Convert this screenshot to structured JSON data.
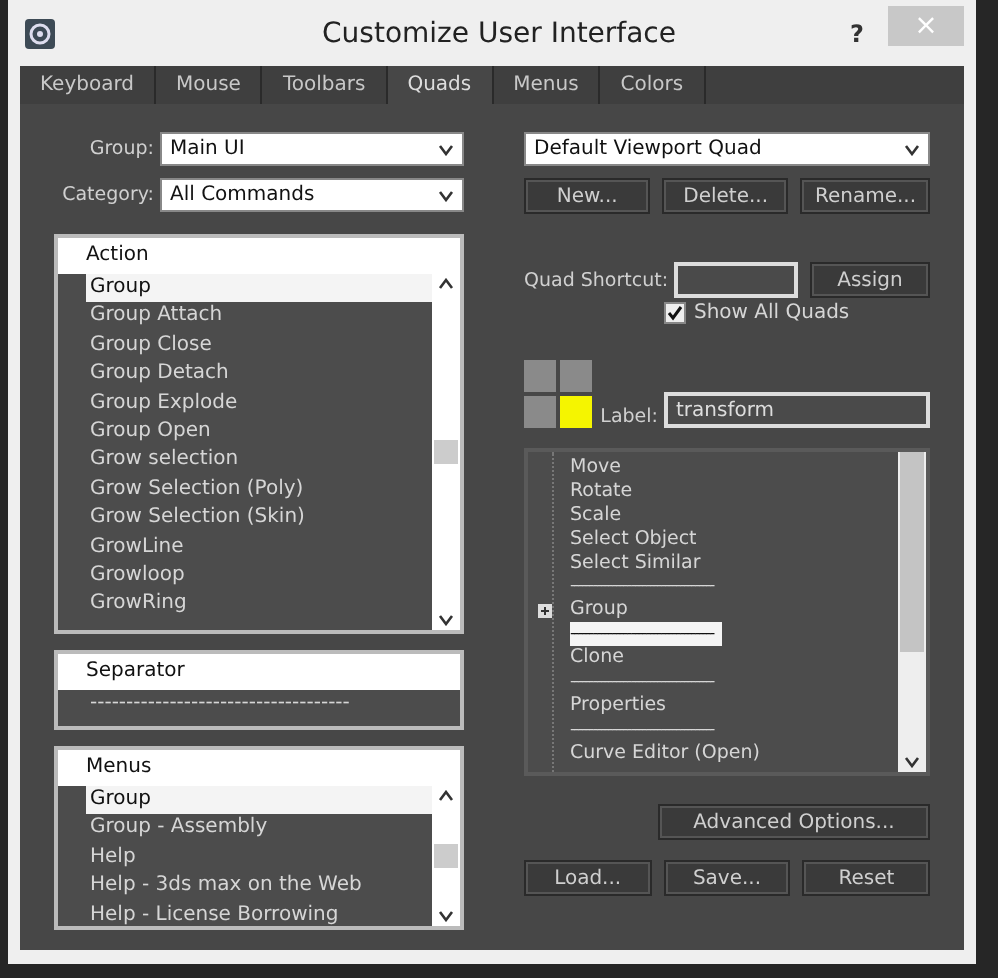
{
  "window": {
    "title": "Customize User Interface",
    "help": "?",
    "close": "×"
  },
  "tabs": [
    {
      "label": "Keyboard",
      "selected": false
    },
    {
      "label": "Mouse",
      "selected": false
    },
    {
      "label": "Toolbars",
      "selected": false
    },
    {
      "label": "Quads",
      "selected": true
    },
    {
      "label": "Menus",
      "selected": false
    },
    {
      "label": "Colors",
      "selected": false
    }
  ],
  "group": {
    "label": "Group:",
    "value": "Main UI"
  },
  "category": {
    "label": "Category:",
    "value": "All Commands"
  },
  "actions": {
    "header": "Action",
    "items": [
      {
        "text": "Group",
        "selected": true
      },
      {
        "text": "Group Attach",
        "selected": false
      },
      {
        "text": "Group Close",
        "selected": false
      },
      {
        "text": "Group Detach",
        "selected": false
      },
      {
        "text": "Group Explode",
        "selected": false
      },
      {
        "text": "Group Open",
        "selected": false
      },
      {
        "text": "Grow selection",
        "selected": false
      },
      {
        "text": "Grow Selection (Poly)",
        "selected": false
      },
      {
        "text": "Grow Selection (Skin)",
        "selected": false
      },
      {
        "text": "GrowLine",
        "selected": false
      },
      {
        "text": "Growloop",
        "selected": false
      },
      {
        "text": "GrowRing",
        "selected": false
      }
    ]
  },
  "separator": {
    "header": "Separator",
    "items": [
      {
        "text": "------------------------------------",
        "selected": false
      }
    ]
  },
  "menus": {
    "header": "Menus",
    "items": [
      {
        "text": "Group",
        "selected": true
      },
      {
        "text": "Group - Assembly",
        "selected": false
      },
      {
        "text": "Help",
        "selected": false
      },
      {
        "text": "Help - 3ds max on the Web",
        "selected": false
      },
      {
        "text": "Help - License Borrowing",
        "selected": false
      }
    ]
  },
  "quad_set": {
    "value": "Default Viewport Quad"
  },
  "quad_buttons": [
    "New...",
    "Delete...",
    "Rename..."
  ],
  "shortcut": {
    "label": "Quad Shortcut:",
    "button": "Assign"
  },
  "show_all": {
    "label": "Show All Quads",
    "checked": true
  },
  "quads": [
    {
      "selected": false
    },
    {
      "selected": false
    },
    {
      "selected": false
    },
    {
      "selected": true
    }
  ],
  "quad_label": {
    "label": "Label:",
    "value": "transform"
  },
  "quad_items": [
    {
      "kind": "item",
      "text": "Move",
      "selected": false
    },
    {
      "kind": "item",
      "text": "Rotate",
      "selected": false
    },
    {
      "kind": "item",
      "text": "Scale",
      "selected": false
    },
    {
      "kind": "item",
      "text": "Select Object",
      "selected": false
    },
    {
      "kind": "item",
      "text": "Select Similar",
      "selected": false
    },
    {
      "kind": "separator",
      "text": "--------------------------------------",
      "selected": false
    },
    {
      "kind": "submenu",
      "text": "Group",
      "selected": false
    },
    {
      "kind": "separator",
      "text": "--------------------------------------",
      "selected": true
    },
    {
      "kind": "item",
      "text": "Clone",
      "selected": false
    },
    {
      "kind": "separator",
      "text": "--------------------------------------",
      "selected": false
    },
    {
      "kind": "item",
      "text": "Properties",
      "selected": false
    },
    {
      "kind": "separator",
      "text": "--------------------------------------",
      "selected": false
    },
    {
      "kind": "item",
      "text": "Curve Editor (Open)",
      "selected": false
    }
  ],
  "advanced": "Advanced Options...",
  "bottom_buttons": [
    "Load...",
    "Save...",
    "Reset"
  ]
}
